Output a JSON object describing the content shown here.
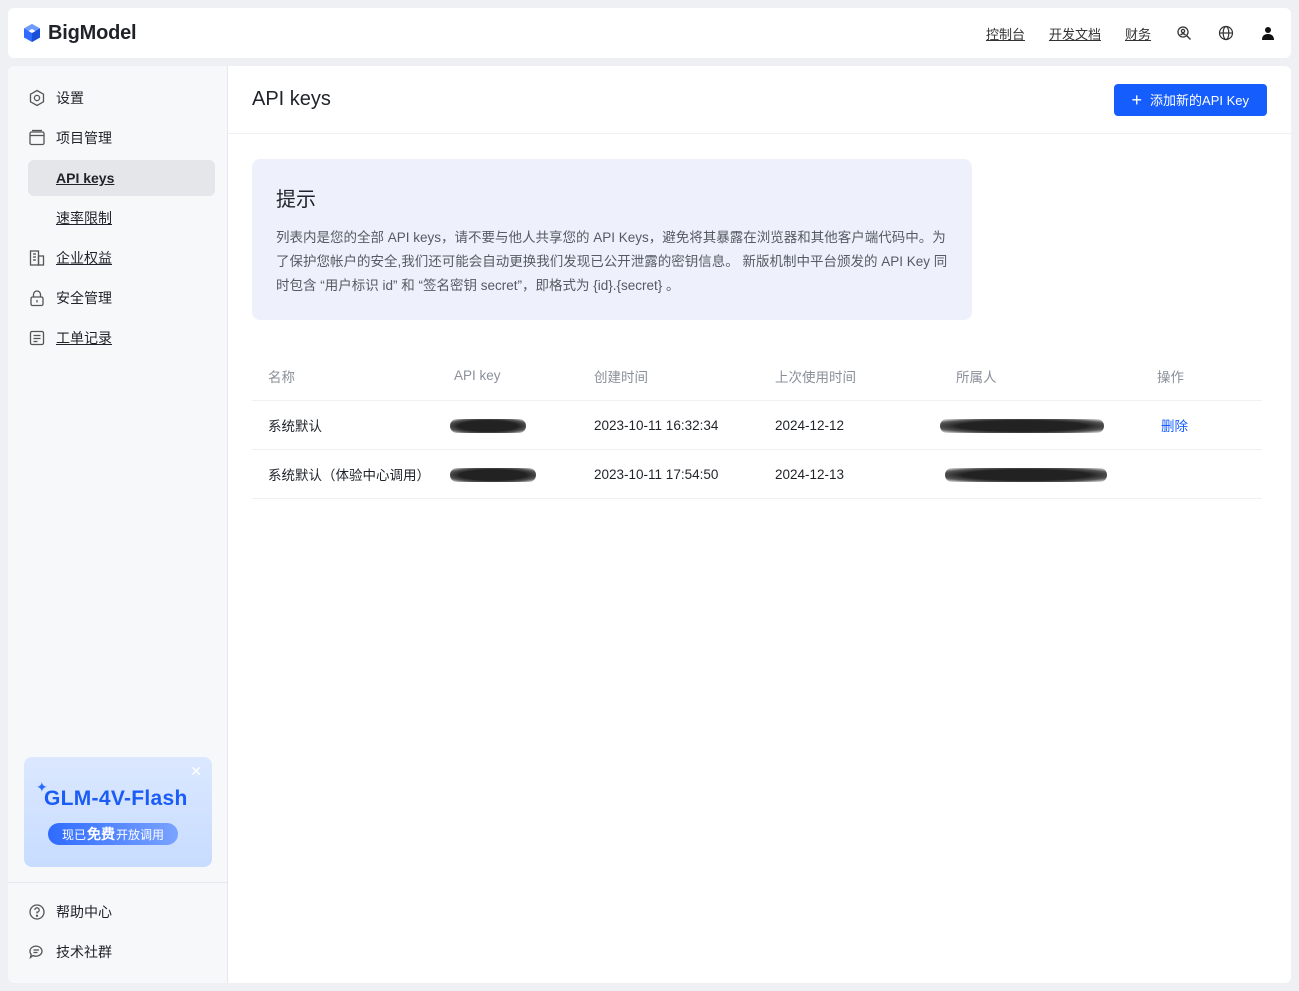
{
  "header": {
    "logo_text": "BigModel",
    "nav": [
      "控制台",
      "开发文档",
      "财务"
    ],
    "icons": [
      "search-user-icon",
      "globe-icon",
      "user-icon"
    ]
  },
  "sidebar": {
    "items": [
      {
        "label": "设置",
        "icon": "settings-icon"
      },
      {
        "label": "项目管理",
        "icon": "project-icon"
      },
      {
        "label": "API keys",
        "active": true
      },
      {
        "label": "速率限制"
      },
      {
        "label": "企业权益",
        "icon": "building-icon"
      },
      {
        "label": "安全管理",
        "icon": "lock-icon"
      },
      {
        "label": "工单记录",
        "icon": "ticket-icon"
      }
    ],
    "promo": {
      "title": "GLM-4V-Flash",
      "sub_prefix": "现已",
      "sub_bold": "免费",
      "sub_suffix": "开放调用"
    },
    "bottom": [
      {
        "label": "帮助中心",
        "icon": "help-icon"
      },
      {
        "label": "技术社群",
        "icon": "chat-icon"
      }
    ]
  },
  "main": {
    "title": "API keys",
    "add_button": "添加新的API Key",
    "tip": {
      "title": "提示",
      "body": "列表内是您的全部 API keys，请不要与他人共享您的 API Keys，避免将其暴露在浏览器和其他客户端代码中。为了保护您帐户的安全,我们还可能会自动更换我们发现已公开泄露的密钥信息。 新版机制中平台颁发的 API Key 同时包含 “用户标识 id” 和 “签名密钥 secret”，即格式为 {id}.{secret} 。"
    },
    "table": {
      "columns": [
        "名称",
        "API key",
        "创建时间",
        "上次使用时间",
        "所属人",
        "操作"
      ],
      "rows": [
        {
          "name": "系统默认",
          "created": "2023-10-11 16:32:34",
          "last_used": "2024-12-12",
          "action": "删除"
        },
        {
          "name": "系统默认（体验中心调用）",
          "created": "2023-10-11 17:54:50",
          "last_used": "2024-12-13",
          "action": ""
        }
      ]
    }
  }
}
